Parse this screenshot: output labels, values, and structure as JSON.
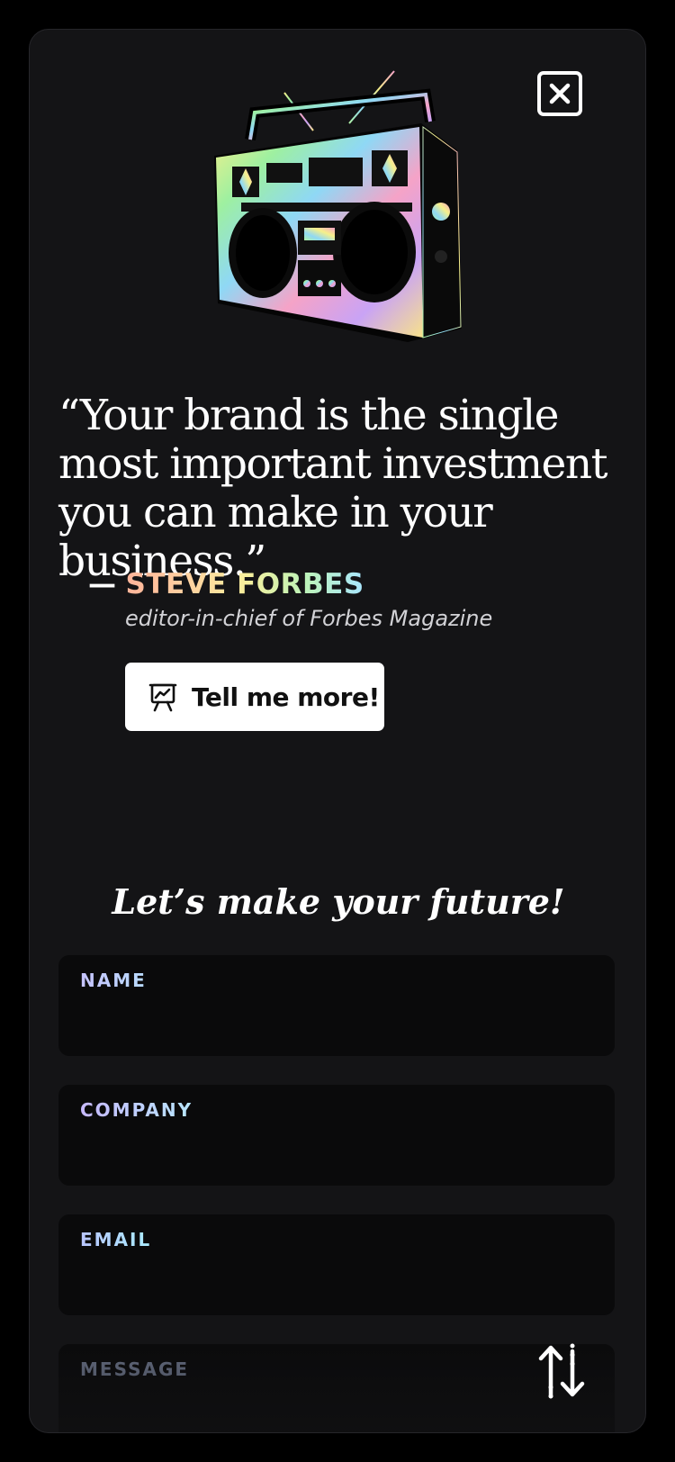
{
  "modal": {
    "close_icon": "close-icon"
  },
  "illustration": {
    "name": "boombox-illustration"
  },
  "quote": {
    "text": "“Your brand is the single most important investment you can make in your business.”",
    "dash": "—",
    "author": "STEVE FORBES",
    "role": "editor-in-chief of Forbes Magazine"
  },
  "cta": {
    "icon": "presentation-chart-icon",
    "label": "Tell me more!"
  },
  "form": {
    "title": "Let’s make your future!",
    "fields": [
      {
        "label": "NAME",
        "value": ""
      },
      {
        "label": "COMPANY",
        "value": ""
      },
      {
        "label": "EMAIL",
        "value": ""
      },
      {
        "label": "MESSAGE",
        "value": ""
      }
    ],
    "sort_icon": "sort-arrows-icon"
  },
  "colors": {
    "background": "#000000",
    "panel": "#141416",
    "field": "#0a0a0b",
    "author_gradient": [
      "#ffb49a",
      "#f8ef9c",
      "#a9e6ff"
    ]
  }
}
